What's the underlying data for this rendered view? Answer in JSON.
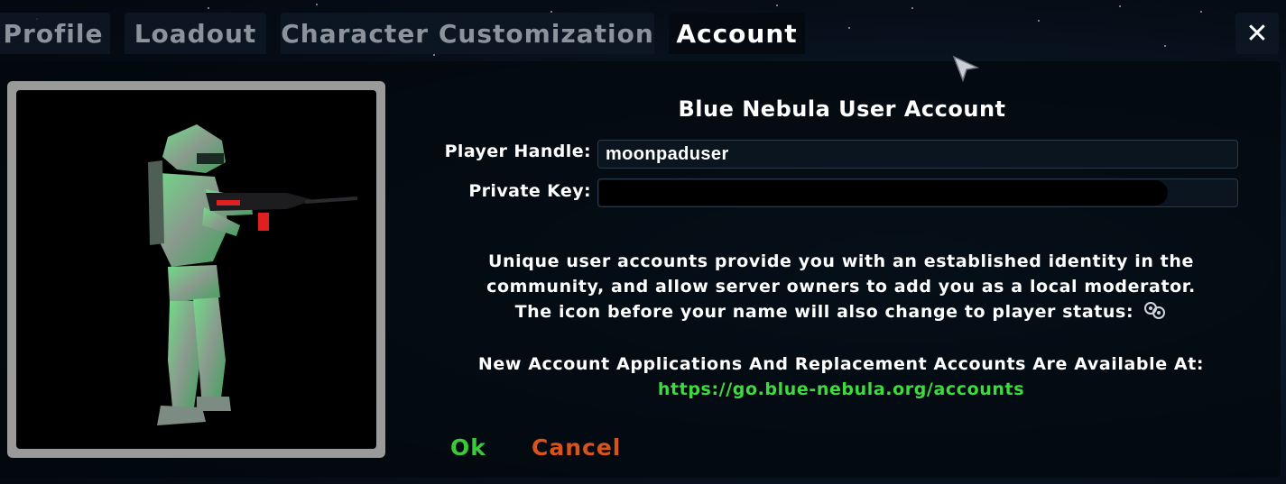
{
  "tabs": [
    {
      "label": "Profile",
      "active": false
    },
    {
      "label": "Loadout",
      "active": false
    },
    {
      "label": "Character Customization",
      "active": false
    },
    {
      "label": "Account",
      "active": true
    }
  ],
  "close_label": "✕",
  "account": {
    "title": "Blue Nebula User Account",
    "handle_label": "Player Handle:",
    "handle_value": "moonpaduser",
    "key_label": "Private Key:",
    "key_value": "",
    "info_line1": "Unique user accounts provide you with an established identity in the",
    "info_line2": "community, and allow server owners to add you as a local moderator.",
    "info_line3": "The icon before your name will also change to player status:",
    "apply_line": "New Account Applications And Replacement Accounts Are Available At:",
    "apply_link": "https://go.blue-nebula.org/accounts",
    "ok_label": "Ok",
    "cancel_label": "Cancel"
  },
  "colors": {
    "link": "#3bdc3b",
    "ok": "#3bc83b",
    "cancel": "#d9531e",
    "tab_inactive_text": "#8d939c",
    "tab_active_text": "#ffffff"
  },
  "icons": {
    "close": "close-icon",
    "status": "player-status-icon",
    "cursor": "mouse-cursor-icon"
  }
}
